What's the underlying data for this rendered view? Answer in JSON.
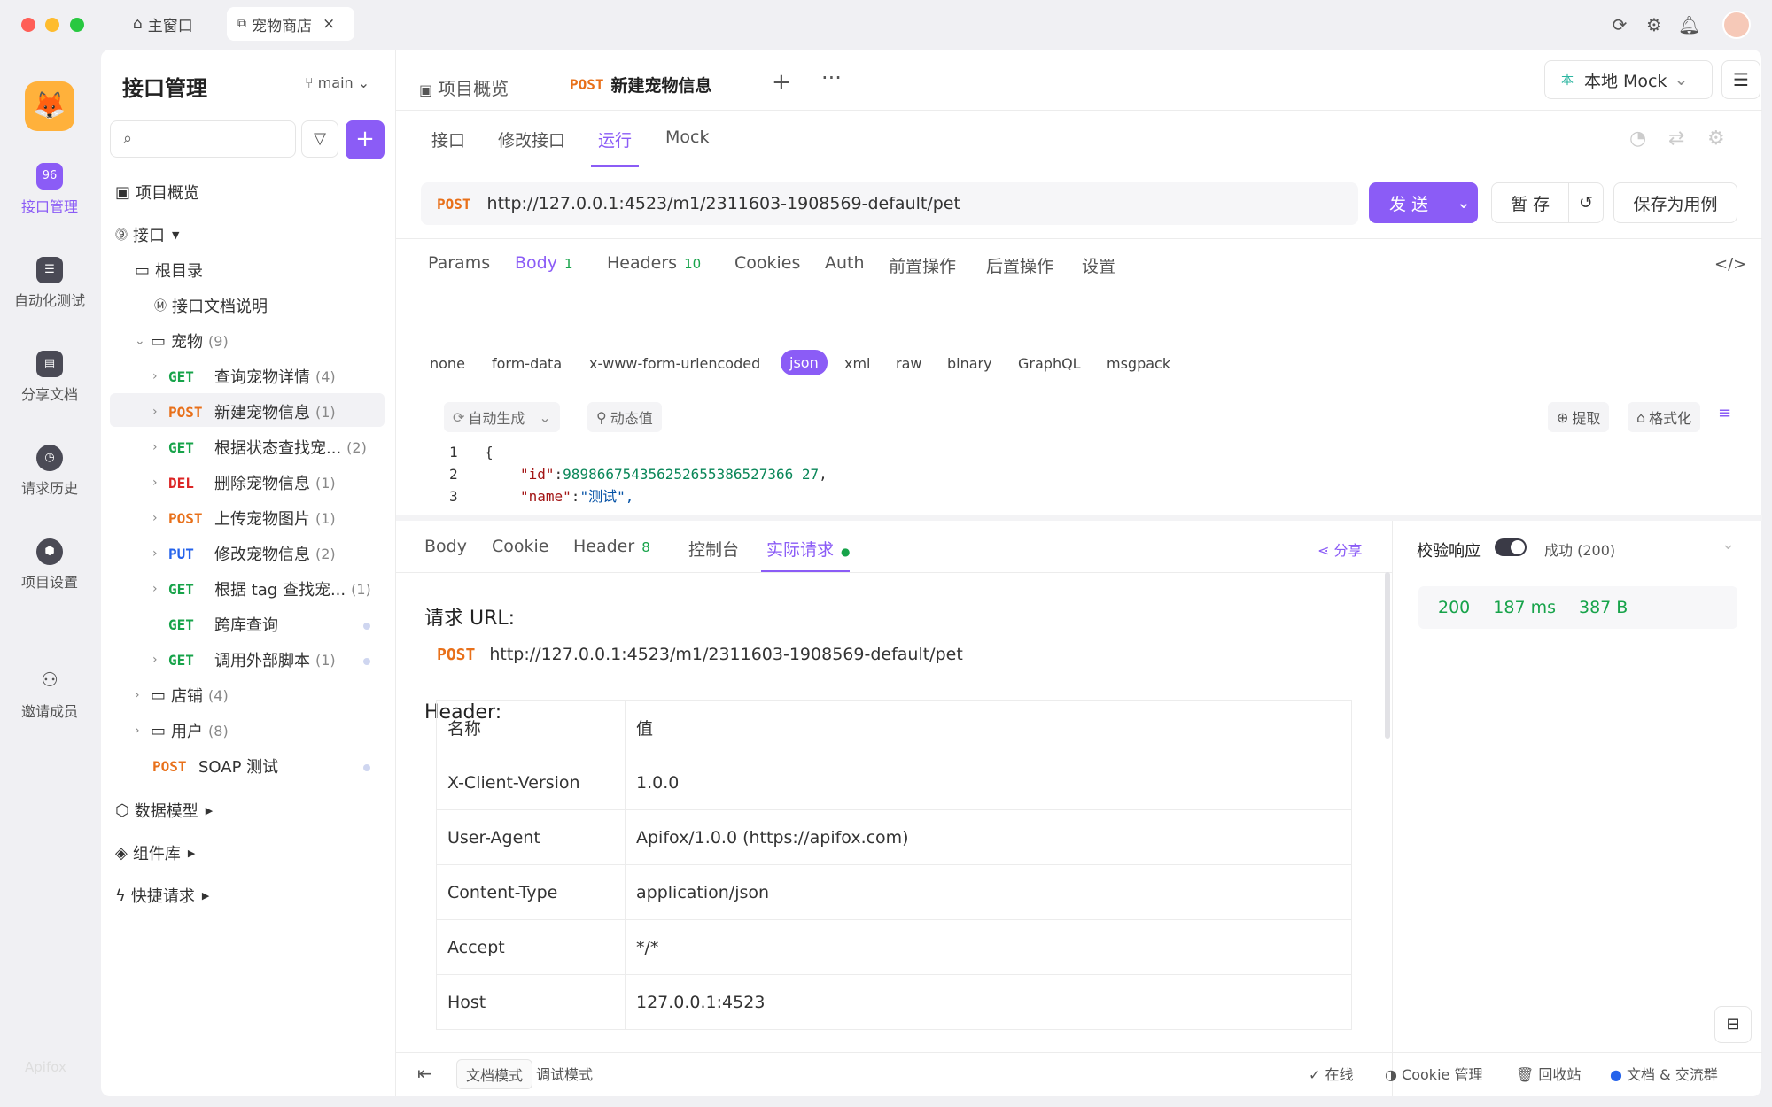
{
  "window": {
    "tabs": [
      {
        "label": "主窗口"
      },
      {
        "label": "宠物商店"
      }
    ]
  },
  "rail": {
    "items": [
      {
        "label": "接口管理",
        "icon": "api-icon"
      },
      {
        "label": "自动化测试",
        "icon": "stack-icon"
      },
      {
        "label": "分享文档",
        "icon": "book-icon"
      },
      {
        "label": "请求历史",
        "icon": "clock-icon"
      },
      {
        "label": "项目设置",
        "icon": "settings-icon"
      },
      {
        "label": "邀请成员",
        "icon": "add-user-icon"
      }
    ],
    "brand": "Apifox"
  },
  "sidebar": {
    "title": "接口管理",
    "branch": "main",
    "search_placeholder": "",
    "tree": [
      {
        "label": "项目概览"
      },
      {
        "label": "接口"
      },
      {
        "label": "根目录"
      },
      {
        "label": "接口文档说明"
      },
      {
        "label": "宠物",
        "count": "(9)"
      },
      {
        "method": "GET",
        "label": "查询宠物详情",
        "count": "(4)"
      },
      {
        "method": "POST",
        "label": "新建宠物信息",
        "count": "(1)"
      },
      {
        "method": "GET",
        "label": "根据状态查找宠...",
        "count": "(2)"
      },
      {
        "method": "DEL",
        "label": "删除宠物信息",
        "count": "(1)"
      },
      {
        "method": "POST",
        "label": "上传宠物图片",
        "count": "(1)"
      },
      {
        "method": "PUT",
        "label": "修改宠物信息",
        "count": "(2)"
      },
      {
        "method": "GET",
        "label": "根据 tag 查找宠...",
        "count": "(1)"
      },
      {
        "method": "GET",
        "label": "跨库查询",
        "count": ""
      },
      {
        "method": "GET",
        "label": "调用外部脚本",
        "count": "(1)"
      },
      {
        "label": "店铺",
        "count": "(4)"
      },
      {
        "label": "用户",
        "count": "(8)"
      },
      {
        "method": "POST",
        "label": "SOAP 测试",
        "count": ""
      },
      {
        "label": "数据模型"
      },
      {
        "label": "组件库"
      },
      {
        "label": "快捷请求"
      }
    ]
  },
  "main": {
    "tabs": [
      {
        "label": "项目概览"
      },
      {
        "method": "POST",
        "label": "新建宠物信息"
      }
    ],
    "env": "本地 Mock",
    "env_prefix": "本",
    "subtabs": [
      "接口",
      "修改接口",
      "运行",
      "Mock"
    ],
    "request": {
      "method": "POST",
      "url": "http://127.0.0.1:4523/m1/2311603-1908569-default/pet",
      "send": "发 送",
      "save_draft": "暂 存",
      "save_case": "保存为用例"
    },
    "params_tabs": [
      {
        "label": "Params"
      },
      {
        "label": "Body",
        "badge": "1"
      },
      {
        "label": "Headers",
        "badge": "10"
      },
      {
        "label": "Cookies"
      },
      {
        "label": "Auth"
      },
      {
        "label": "前置操作"
      },
      {
        "label": "后置操作"
      },
      {
        "label": "设置"
      }
    ],
    "body_types": [
      "none",
      "form-data",
      "x-www-form-urlencoded",
      "json",
      "xml",
      "raw",
      "binary",
      "GraphQL",
      "msgpack"
    ],
    "editor_tools": {
      "auto": "自动生成",
      "dynamic": "动态值",
      "extract": "提取",
      "format": "格式化"
    },
    "code_lines": [
      {
        "n": "1",
        "text": "{"
      },
      {
        "n": "2",
        "key": "\"id\"",
        "val": "989866754356252655386527366 27"
      },
      {
        "n": "3",
        "key": "\"name\"",
        "val": "\"测试\","
      }
    ],
    "resp_tabs": [
      {
        "label": "Body"
      },
      {
        "label": "Cookie"
      },
      {
        "label": "Header",
        "badge": "8"
      },
      {
        "label": "控制台"
      },
      {
        "label": "实际请求"
      }
    ],
    "share": "分享",
    "actual": {
      "url_title": "请求 URL:",
      "method": "POST",
      "url": "http://127.0.0.1:4523/m1/2311603-1908569-default/pet",
      "header_title": "Header:",
      "header_cols": [
        "名称",
        "值"
      ],
      "headers": [
        {
          "k": "X-Client-Version",
          "v": "1.0.0"
        },
        {
          "k": "User-Agent",
          "v": "Apifox/1.0.0 (https://apifox.com)"
        },
        {
          "k": "Content-Type",
          "v": "application/json"
        },
        {
          "k": "Accept",
          "v": "*/*"
        },
        {
          "k": "Host",
          "v": "127.0.0.1:4523"
        }
      ]
    },
    "validate": {
      "label": "校验响应",
      "result": "成功 (200)",
      "status": "200",
      "time": "187 ms",
      "size": "387 B"
    }
  },
  "footer": {
    "doc_mode": "文档模式",
    "debug_mode": "调试模式",
    "online": "在线",
    "cookie": "Cookie 管理",
    "trash": "回收站",
    "community": "文档 & 交流群"
  }
}
